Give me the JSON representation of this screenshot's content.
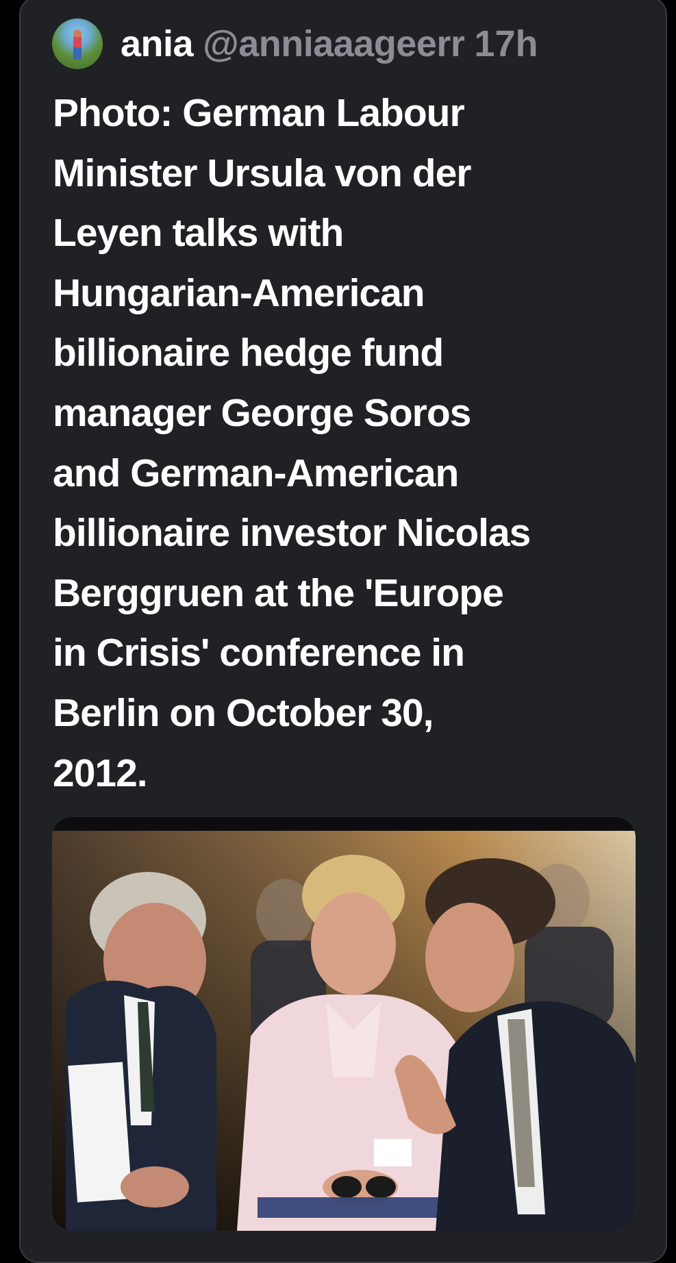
{
  "tweet": {
    "author": {
      "display_name": "ania",
      "handle": "@anniaaageerr",
      "time": "17h"
    },
    "text_lines": [
      "Photo: German Labour",
      "Minister Ursula von der",
      "Leyen talks with",
      "Hungarian-American",
      "billionaire hedge fund",
      "manager George Soros",
      "and German-American",
      "billionaire investor Nicolas",
      "Berggruen at the 'Europe",
      "in Crisis' conference in",
      "Berlin on October 30,",
      "2012."
    ],
    "media": {
      "kind": "photo",
      "icon": "photo-icon"
    }
  },
  "colors": {
    "card_background": "#202125",
    "page_background": "#000000",
    "text_primary": "#ffffff",
    "text_secondary": "#8a8d93"
  }
}
